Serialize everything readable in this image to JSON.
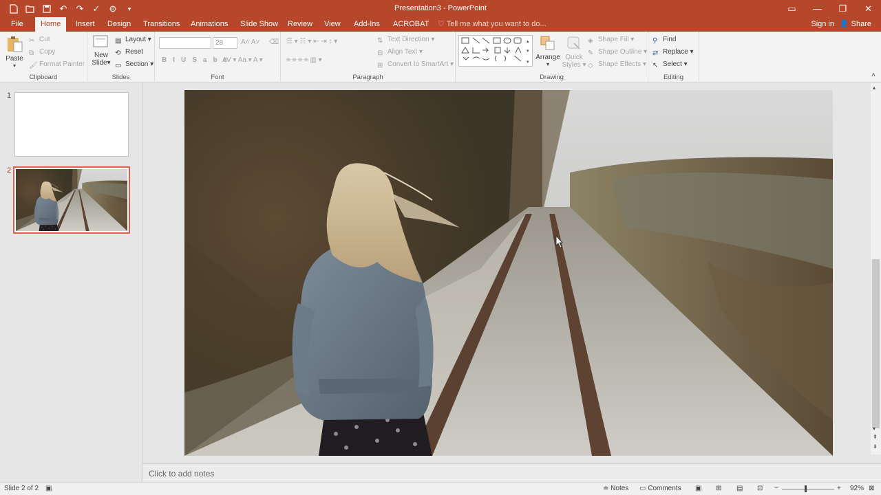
{
  "window": {
    "title": "Presentation3 - PowerPoint"
  },
  "qat": [
    {
      "icon": "new-file-icon"
    },
    {
      "icon": "open-icon"
    },
    {
      "icon": "save-icon"
    },
    {
      "icon": "undo-icon"
    },
    {
      "icon": "redo-icon"
    },
    {
      "icon": "spelling-icon"
    },
    {
      "icon": "present-icon"
    },
    {
      "icon": "customize-icon"
    }
  ],
  "tabs": [
    "File",
    "Home",
    "Insert",
    "Design",
    "Transitions",
    "Animations",
    "Slide Show",
    "Review",
    "View",
    "Add-Ins",
    "ACROBAT"
  ],
  "active_tab": "Home",
  "tell_me": "Tell me what you want to do...",
  "account": {
    "signin": "Sign in",
    "share": "Share"
  },
  "ribbon": {
    "clipboard": {
      "paste": "Paste",
      "cut": "Cut",
      "copy": "Copy",
      "format_painter": "Format Painter",
      "label": "Clipboard"
    },
    "slides": {
      "new_slide_line1": "New",
      "new_slide_line2": "Slide",
      "layout": "Layout",
      "reset": "Reset",
      "section": "Section",
      "label": "Slides"
    },
    "font": {
      "font_name": "",
      "font_size": "28",
      "label": "Font"
    },
    "paragraph": {
      "text_direction": "Text Direction",
      "align_text": "Align Text",
      "convert_smartart": "Convert to SmartArt",
      "label": "Paragraph"
    },
    "drawing": {
      "arrange": "Arrange",
      "quick_styles_line1": "Quick",
      "quick_styles_line2": "Styles",
      "shape_fill": "Shape Fill",
      "shape_outline": "Shape Outline",
      "shape_effects": "Shape Effects",
      "label": "Drawing"
    },
    "editing": {
      "find": "Find",
      "replace": "Replace",
      "select": "Select",
      "label": "Editing"
    }
  },
  "thumbnails": [
    {
      "number": "1",
      "selected": false
    },
    {
      "number": "2",
      "selected": true
    }
  ],
  "notes_placeholder": "Click to add notes",
  "status": {
    "slide_info": "Slide 2 of 2",
    "notes": "Notes",
    "comments": "Comments",
    "zoom": "92%"
  },
  "colors": {
    "accent": "#b7472a",
    "selected_thumb_border": "#e0604a"
  }
}
